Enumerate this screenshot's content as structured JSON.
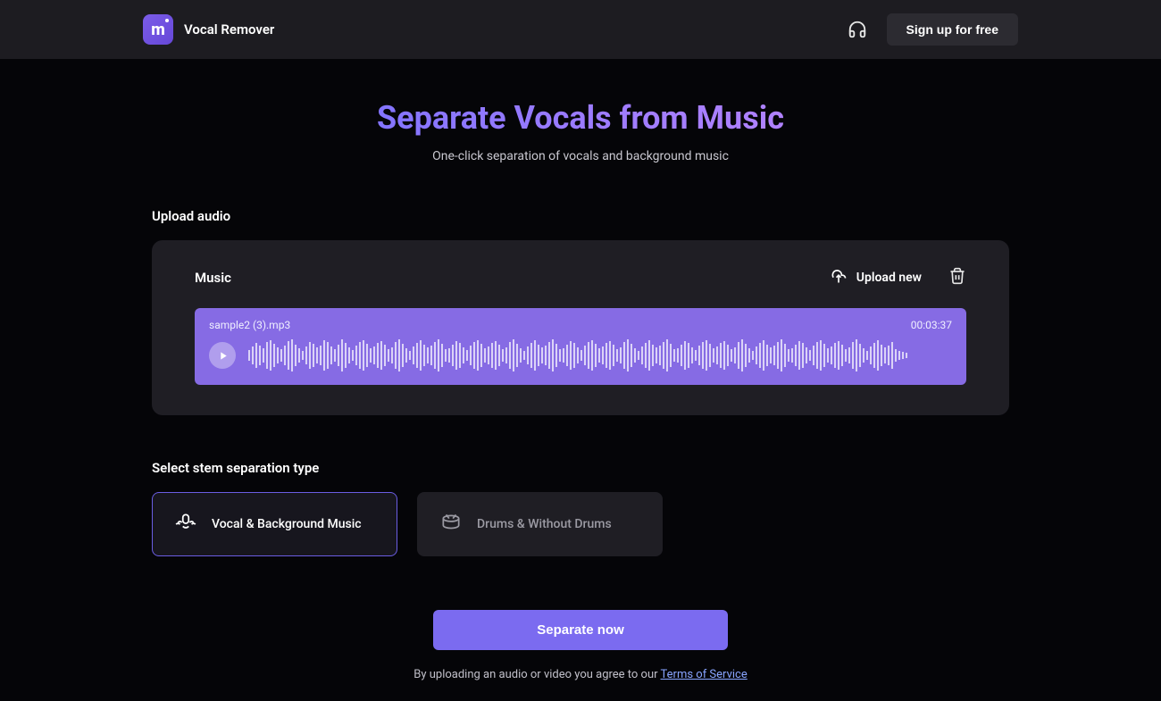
{
  "header": {
    "app_title": "Vocal Remover",
    "signup_label": "Sign up for free"
  },
  "hero": {
    "title": "Separate Vocals from Music",
    "subtitle": "One-click separation of vocals and background music"
  },
  "upload": {
    "section_label": "Upload audio",
    "music_label": "Music",
    "upload_new_label": "Upload new",
    "file_name": "sample2 (3).mp3",
    "duration": "00:03:37"
  },
  "stems": {
    "section_label": "Select stem separation type",
    "options": [
      {
        "label": "Vocal & Background Music",
        "selected": true
      },
      {
        "label": "Drums & Without Drums",
        "selected": false
      }
    ]
  },
  "cta": {
    "button_label": "Separate now",
    "tos_prefix": "By uploading an audio or video you agree to our ",
    "tos_link": "Terms of Service"
  }
}
